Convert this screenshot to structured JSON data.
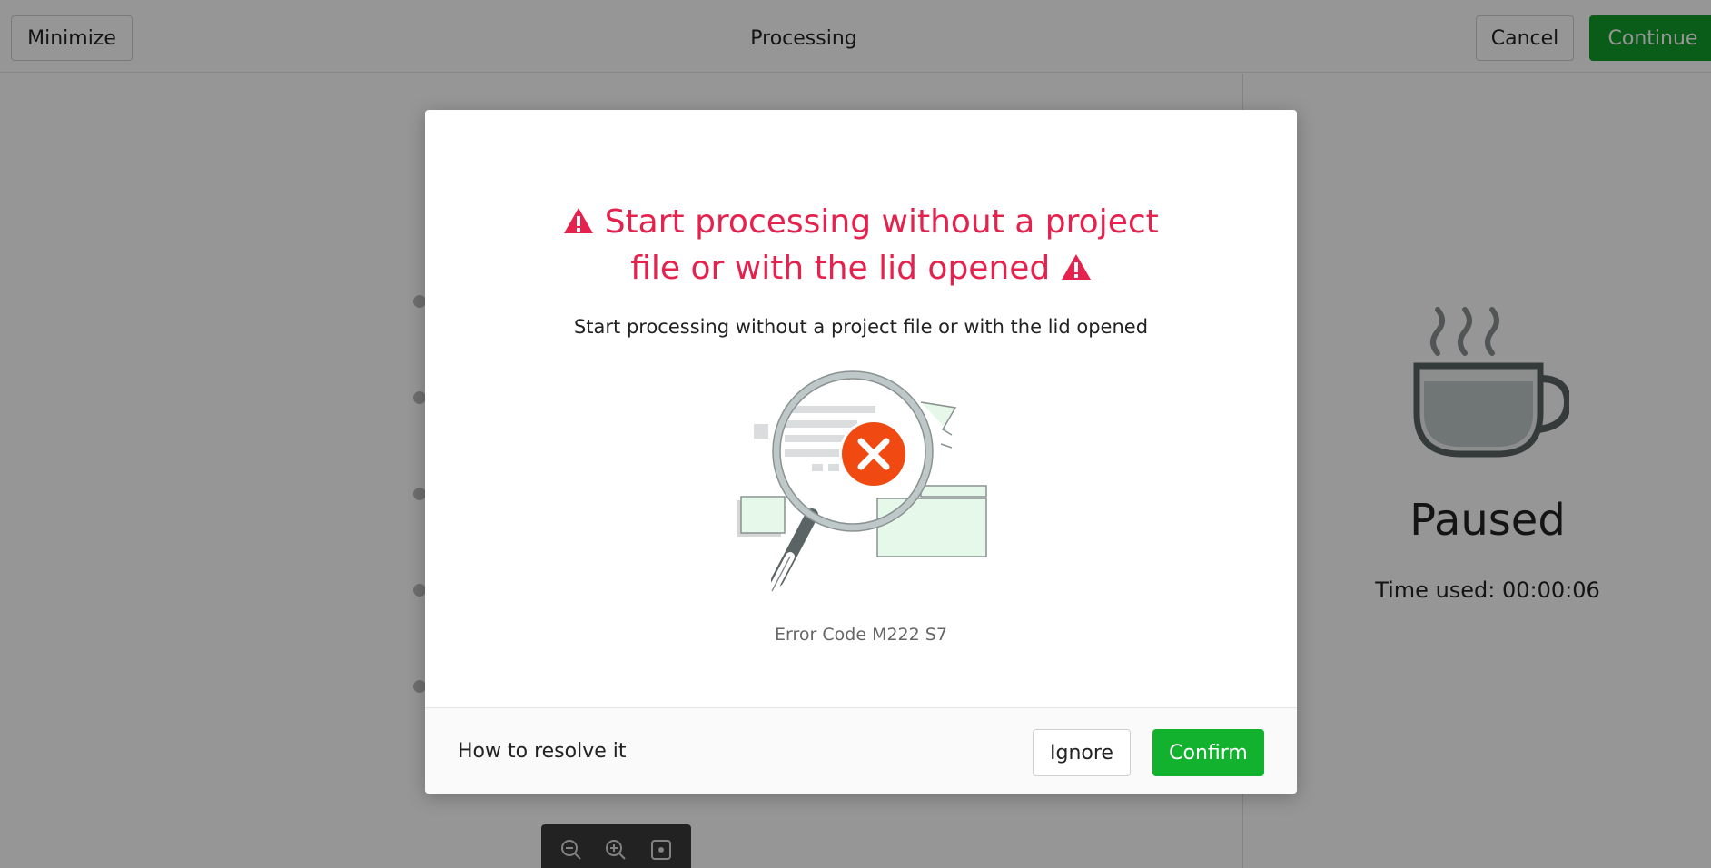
{
  "topbar": {
    "minimize_label": "Minimize",
    "title": "Processing",
    "cancel_label": "Cancel",
    "continue_label": "Continue"
  },
  "status_panel": {
    "icon": "coffee-cup-icon",
    "status": "Paused",
    "time_used": "Time used: 00:00:06"
  },
  "zoom_toolbar": {
    "icons": [
      "zoom-out-icon",
      "zoom-in-icon",
      "fit-view-icon"
    ]
  },
  "dialog": {
    "title": "Start processing without a project file or with the lid opened",
    "description": "Start processing without a project file or with the lid opened",
    "illustration": "magnifier-error-icon",
    "error_code": "Error Code M222 S7",
    "resolve_link": "How to resolve it",
    "ignore_label": "Ignore",
    "confirm_label": "Confirm"
  },
  "colors": {
    "accent_green": "#13b22e",
    "continue_green": "#119e2a",
    "error_red": "#e5224d"
  }
}
